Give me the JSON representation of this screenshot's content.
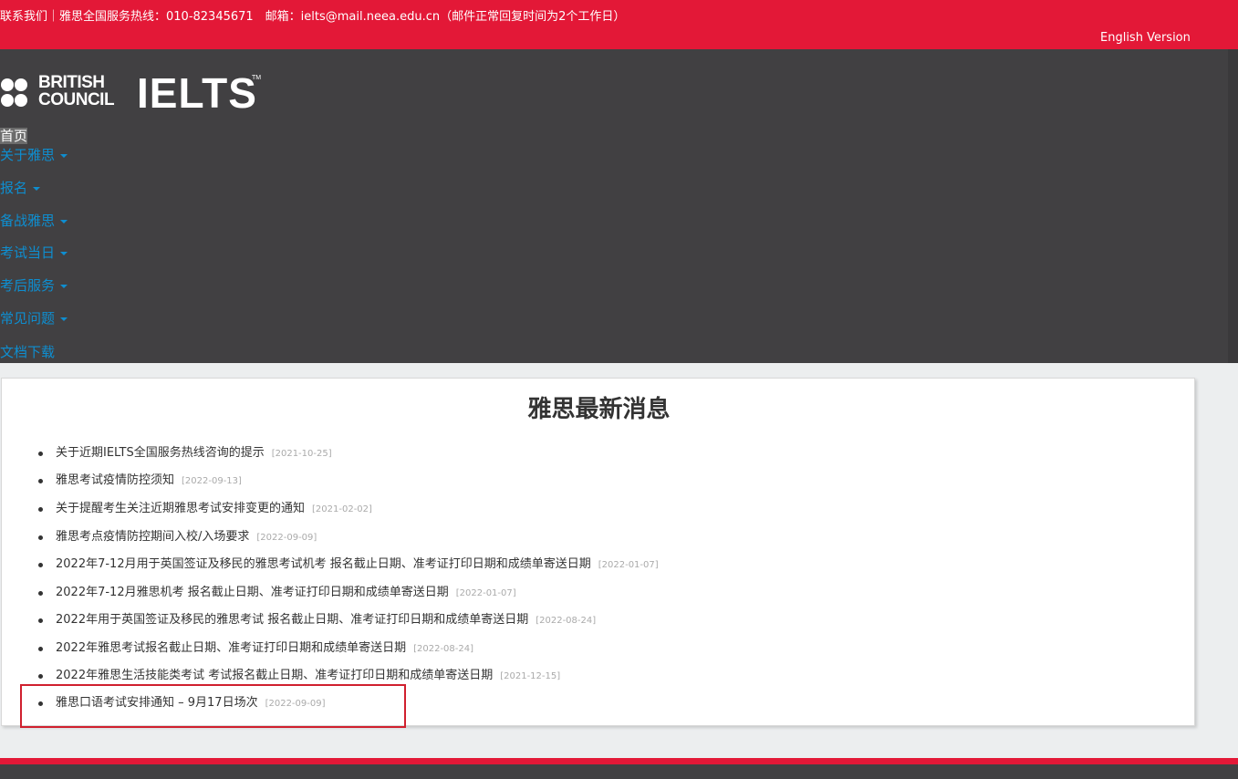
{
  "topbar": {
    "contact": "联系我们｜雅思全国服务热线：010-82345671　邮箱：ielts@mail.neea.edu.cn（邮件正常回复时间为2个工作日）",
    "english_version": "English Version"
  },
  "logo": {
    "british": "BRITISH",
    "council": "COUNCIL",
    "ielts": "IELTS",
    "tm": "TM"
  },
  "nav": [
    {
      "label": "首页",
      "dropdown": false
    },
    {
      "label": "关于雅思",
      "dropdown": true
    },
    {
      "label": "报名",
      "dropdown": true
    },
    {
      "label": "备战雅思",
      "dropdown": true
    },
    {
      "label": "考试当日",
      "dropdown": true
    },
    {
      "label": "考后服务",
      "dropdown": true
    },
    {
      "label": "常见问题",
      "dropdown": true
    },
    {
      "label": "文档下载",
      "dropdown": false
    }
  ],
  "news": {
    "title": "雅思最新消息",
    "items": [
      {
        "title": "关于近期IELTS全国服务热线咨询的提示",
        "date": "[2021-10-25]"
      },
      {
        "title": "雅思考试疫情防控须知",
        "date": "[2022-09-13]"
      },
      {
        "title": "关于提醒考生关注近期雅思考试安排变更的通知",
        "date": "[2021-02-02]"
      },
      {
        "title": "雅思考点疫情防控期间入校/入场要求",
        "date": "[2022-09-09]"
      },
      {
        "title": "2022年7-12月用于英国签证及移民的雅思考试机考 报名截止日期、准考证打印日期和成绩单寄送日期",
        "date": "[2022-01-07]"
      },
      {
        "title": "2022年7-12月雅思机考 报名截止日期、准考证打印日期和成绩单寄送日期",
        "date": "[2022-01-07]"
      },
      {
        "title": "2022年用于英国签证及移民的雅思考试 报名截止日期、准考证打印日期和成绩单寄送日期",
        "date": "[2022-08-24]"
      },
      {
        "title": "2022年雅思考试报名截止日期、准考证打印日期和成绩单寄送日期",
        "date": "[2022-08-24]"
      },
      {
        "title": "2022年雅思生活技能类考试 考试报名截止日期、准考证打印日期和成绩单寄送日期",
        "date": "[2021-12-15]"
      },
      {
        "title": "雅思口语考试安排通知 – 9月17日场次",
        "date": "[2022-09-09]"
      }
    ]
  },
  "colors": {
    "brand_red": "#e31837",
    "header_dark": "#414042",
    "nav_link": "#0e8ed0",
    "highlight_border": "#d0202e"
  }
}
